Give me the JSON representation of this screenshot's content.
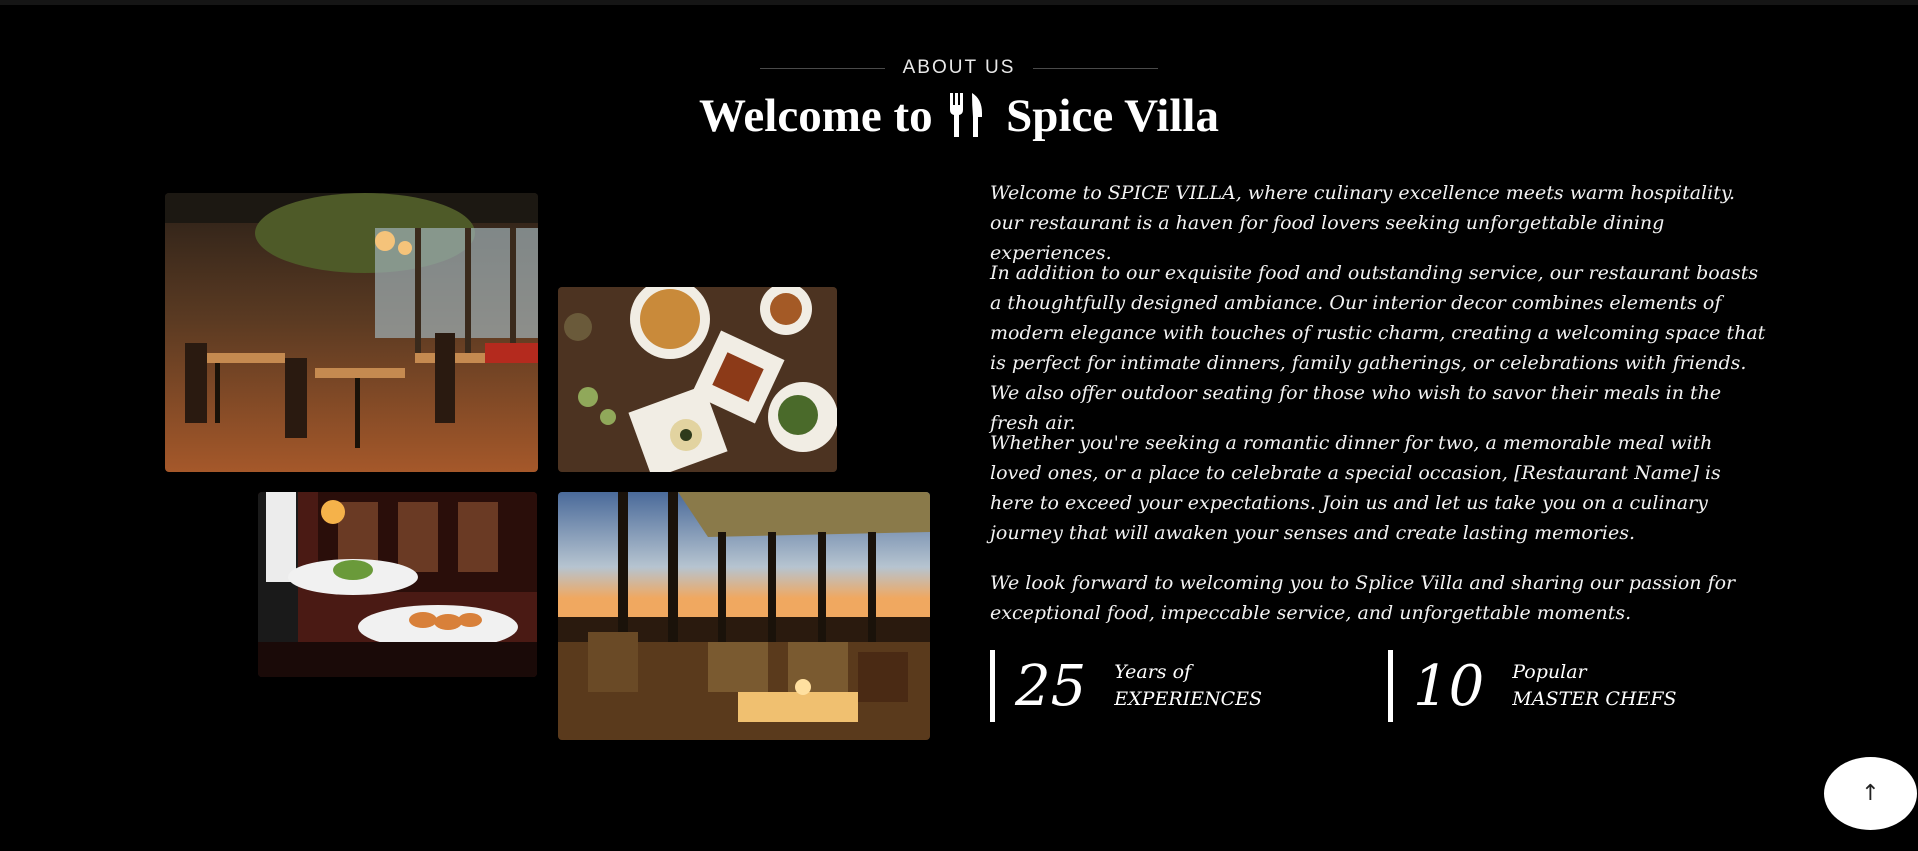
{
  "about": {
    "eyebrow": "ABOUT US",
    "title_prefix": "Welcome to",
    "title_icon": "fork-knife-icon",
    "title_suffix": "Spice Villa"
  },
  "paragraphs": [
    "Welcome to SPICE VILLA, where culinary excellence meets warm hospitality. our restaurant is a haven for food lovers seeking unforgettable dining experiences.",
    "In addition to our exquisite food and outstanding service, our restaurant boasts a thoughtfully designed ambiance. Our interior decor combines elements of modern elegance with touches of rustic charm, creating a welcoming space that is perfect for intimate dinners, family gatherings, or celebrations with friends. We also offer outdoor seating for those who wish to savor their meals in the fresh air.",
    "Whether you're seeking a romantic dinner for two, a memorable meal with loved ones, or a place to celebrate a special occasion, [Restaurant Name] is here to exceed your expectations. Join us and let us take you on a culinary journey that will awaken your senses and create lasting memories.",
    "We look forward to welcoming you to Splice Villa and sharing our passion for exceptional food, impeccable service, and unforgettable moments."
  ],
  "stats": [
    {
      "number": "25",
      "label_line1": "Years of",
      "label_line2": "EXPERIENCES"
    },
    {
      "number": "10",
      "label_line1": "Popular",
      "label_line2": "MASTER CHEFS"
    }
  ],
  "images": [
    {
      "name": "restaurant-interior-photo"
    },
    {
      "name": "food-platter-photo"
    },
    {
      "name": "waiter-serving-photo"
    },
    {
      "name": "sunset-dining-photo"
    }
  ],
  "back_to_top": {
    "icon": "arrow-up-icon",
    "glyph": "↑"
  },
  "colors": {
    "background": "#000000",
    "text": "#ffffff"
  }
}
